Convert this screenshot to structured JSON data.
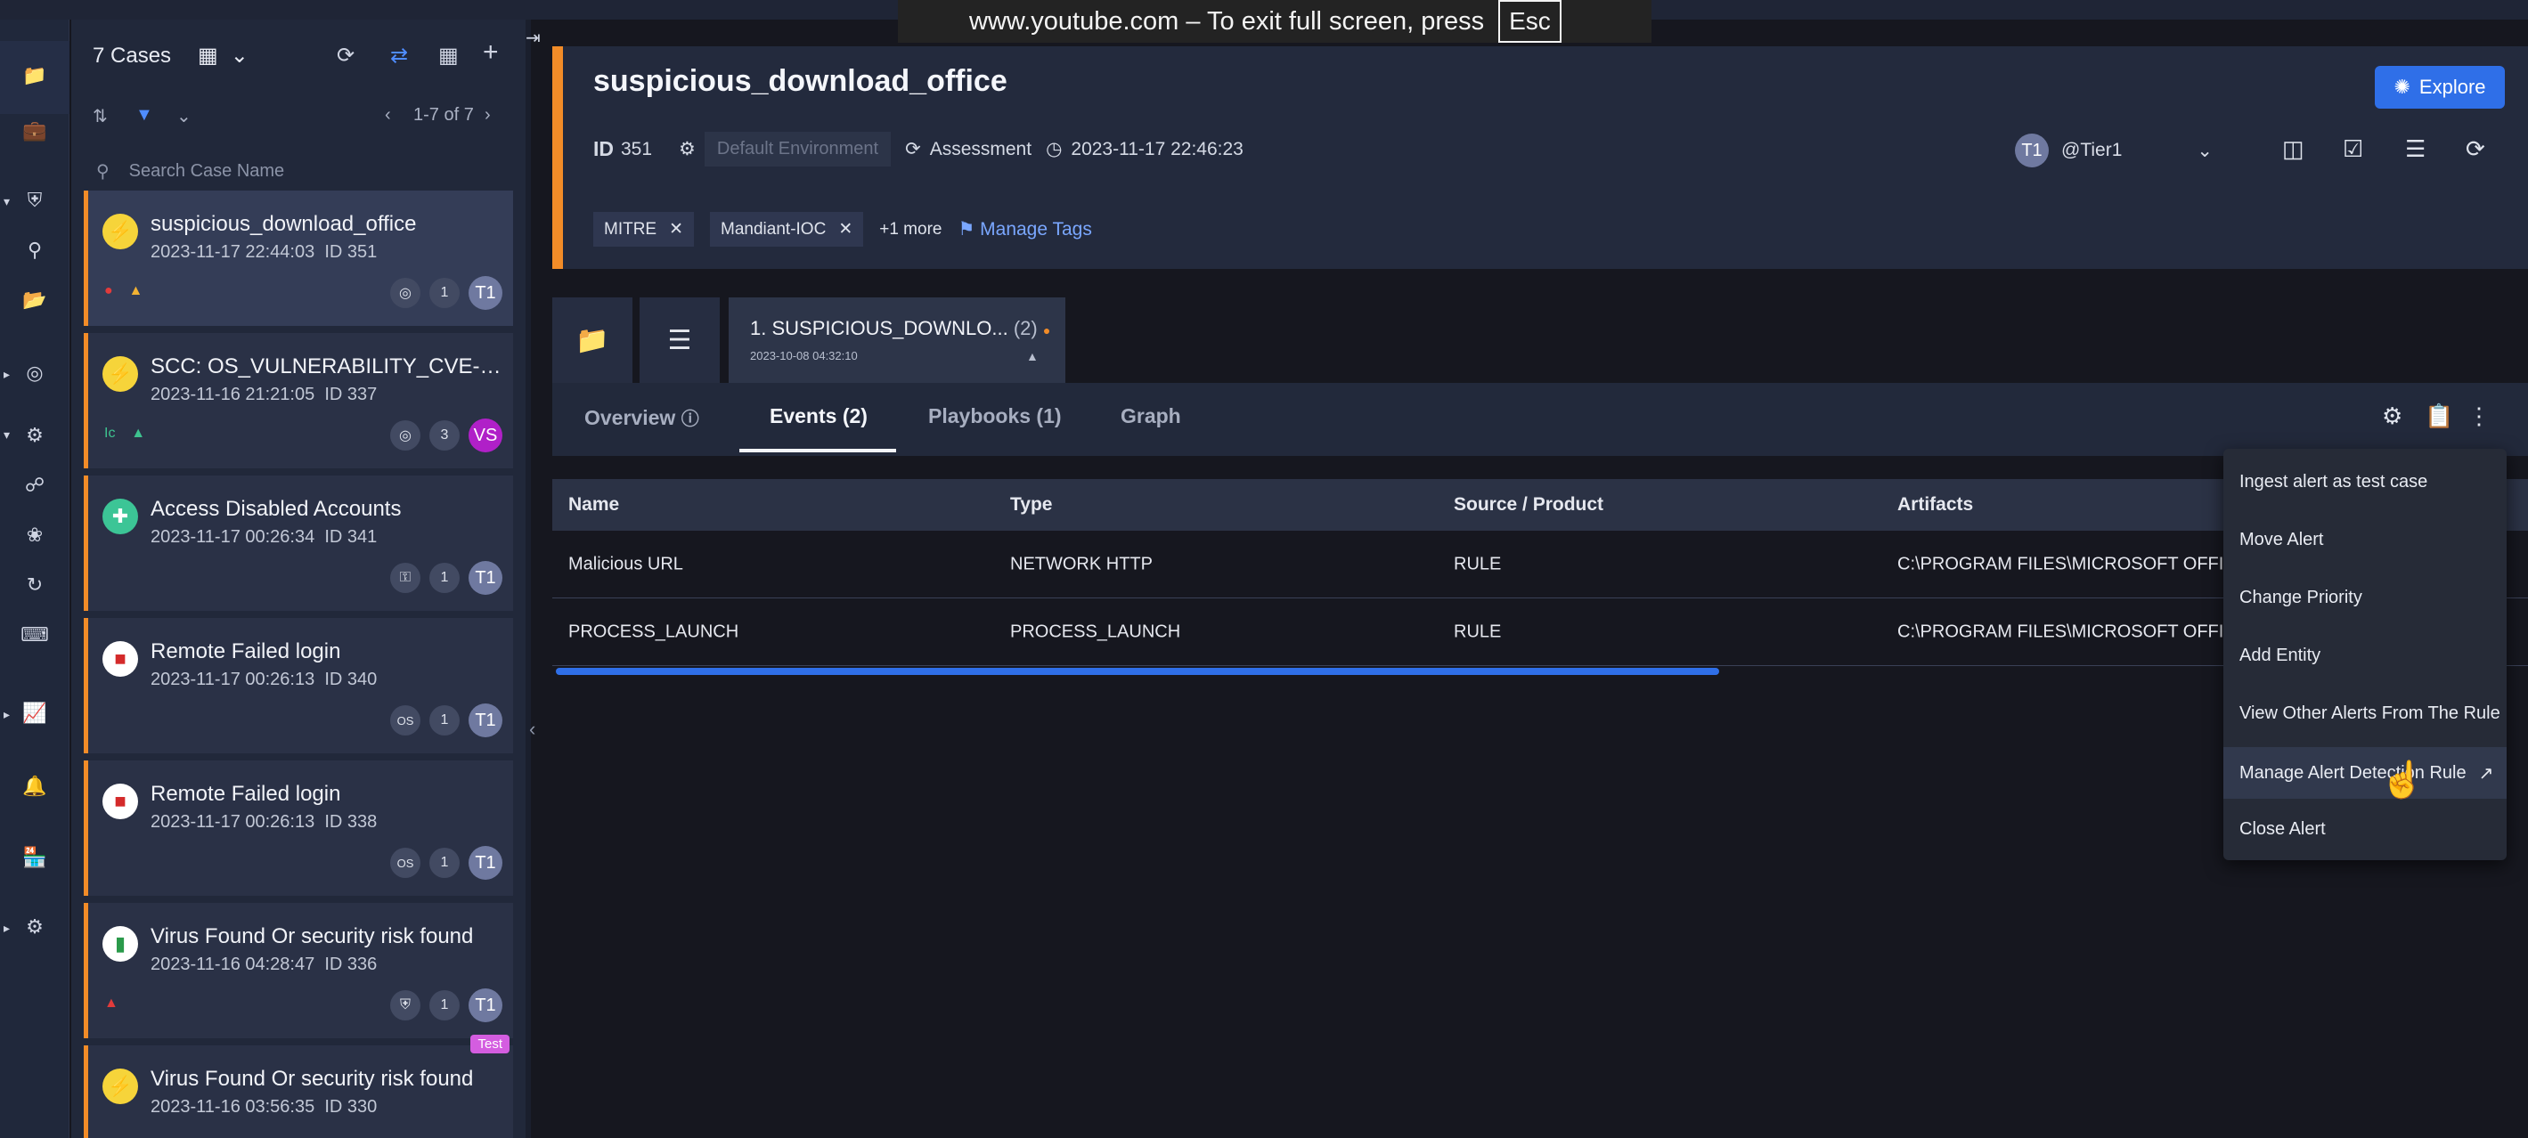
{
  "browser": {
    "fullscreen_text": "www.youtube.com – To exit full screen, press",
    "esc_key": "Esc"
  },
  "case_list": {
    "count_label": "7 Cases",
    "pagination": "1-7 of 7",
    "search_placeholder": "Search Case Name",
    "cases": [
      {
        "title": "suspicious_download_office",
        "date": "2023-11-17 22:44:03",
        "id": "ID 351",
        "count": "1",
        "badge": "T1"
      },
      {
        "title": "SCC: OS_VULNERABILITY_CVE-2023-...",
        "date": "2023-11-16 21:21:05",
        "id": "ID 337",
        "count": "3",
        "badge": "VS"
      },
      {
        "title": "Access Disabled Accounts",
        "date": "2023-11-17 00:26:34",
        "id": "ID 341",
        "count": "1",
        "badge": "T1"
      },
      {
        "title": "Remote Failed login",
        "date": "2023-11-17 00:26:13",
        "id": "ID 340",
        "os": "OS",
        "count": "1",
        "badge": "T1"
      },
      {
        "title": "Remote Failed login",
        "date": "2023-11-17 00:26:13",
        "id": "ID 338",
        "os": "OS",
        "count": "1",
        "badge": "T1"
      },
      {
        "title": "Virus Found Or security risk found",
        "date": "2023-11-16 04:28:47",
        "id": "ID 336",
        "count": "1",
        "badge": "T1"
      },
      {
        "title": "Virus Found Or security risk found",
        "date": "2023-11-16 03:56:35",
        "id": "ID 330",
        "test_badge": "Test"
      }
    ]
  },
  "case": {
    "title": "suspicious_download_office",
    "id_label": "ID",
    "id_value": "351",
    "environment": "Default Environment",
    "stage": "Assessment",
    "created": "2023-11-17 22:46:23",
    "assignee_avatar": "T1",
    "assignee": "@Tier1",
    "tags": [
      "MITRE",
      "Mandiant-IOC"
    ],
    "more_tags": "+1 more",
    "manage_tags": "Manage Tags",
    "explore": "Explore"
  },
  "alert_tab": {
    "title": "1. SUSPICIOUS_DOWNLO...",
    "count": "(2)",
    "date": "2023-10-08 04:32:10"
  },
  "subtabs": {
    "overview": "Overview",
    "events": "Events (2)",
    "playbooks": "Playbooks (1)",
    "graph": "Graph"
  },
  "events_table": {
    "columns": [
      "Name",
      "Type",
      "Source / Product",
      "Artifacts"
    ],
    "rows": [
      [
        "Malicious URL",
        "NETWORK HTTP",
        "RULE",
        "C:\\PROGRAM FILES\\MICROSOFT OFFICE\\O"
      ],
      [
        "PROCESS_LAUNCH",
        "PROCESS_LAUNCH",
        "RULE",
        "C:\\PROGRAM FILES\\MICROSOFT OFFICE\\O"
      ]
    ]
  },
  "alert_menu": {
    "items": [
      "Ingest alert as test case",
      "Move Alert",
      "Change Priority",
      "Add Entity",
      "View Other Alerts From The Rule",
      "Manage Alert Detection Rule",
      "Close Alert"
    ]
  },
  "colors": {
    "accent_orange": "#f28c28",
    "primary_blue": "#2f6fe8",
    "link_blue": "#7aa7ff"
  }
}
